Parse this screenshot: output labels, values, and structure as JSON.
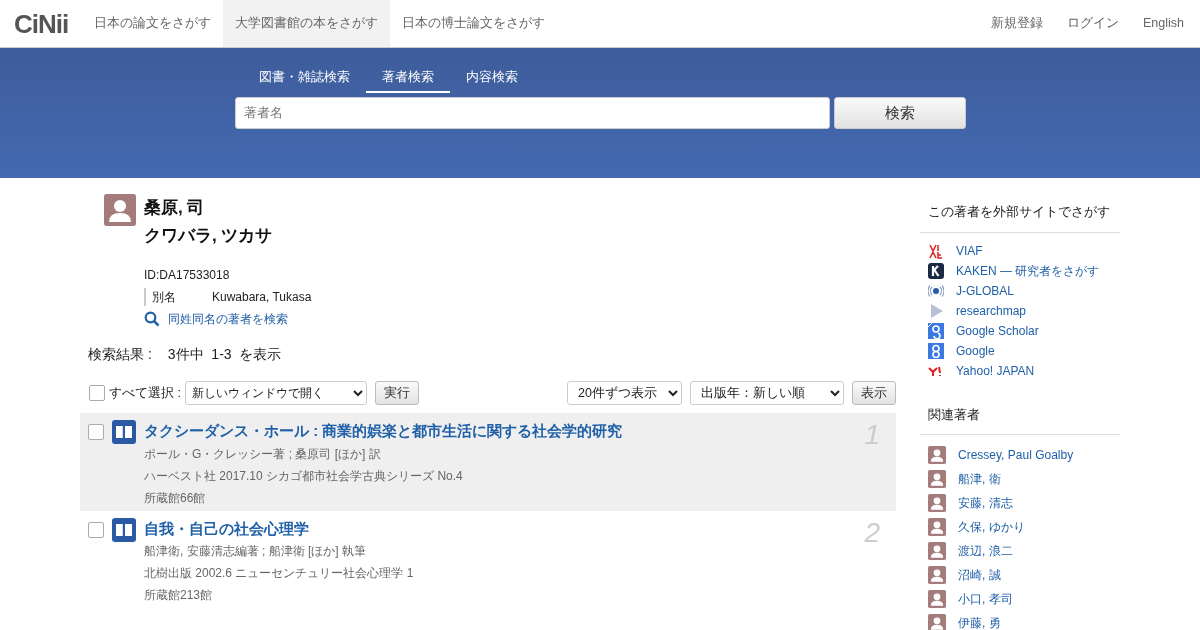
{
  "header": {
    "logo": "CiNii",
    "nav": [
      {
        "label": "日本の論文をさがす",
        "selected": false
      },
      {
        "label": "大学図書館の本をさがす",
        "selected": true
      },
      {
        "label": "日本の博士論文をさがす",
        "selected": false
      }
    ],
    "right_links": [
      "新規登録",
      "ログイン",
      "English"
    ]
  },
  "search": {
    "tabs": [
      {
        "label": "図書・雑誌検索",
        "selected": false
      },
      {
        "label": "著者検索",
        "selected": true
      },
      {
        "label": "内容検索",
        "selected": false
      }
    ],
    "placeholder": "著者名",
    "button": "検索"
  },
  "author": {
    "name": "桑原, 司",
    "kana": "クワバラ, ツカサ",
    "id": "ID:DA17533018",
    "alias_label": "別名",
    "alias": "Kuwabara, Tukasa",
    "same_name_link": "同姓同名の著者を検索"
  },
  "results": {
    "summary_label": "検索結果 :",
    "summary": "3件中  1-3  を表示",
    "select_all": {
      "label": "すべて選択 :",
      "checked": false
    },
    "action_select": "新しいウィンドウで開く",
    "action_button": "実行",
    "per_page_select": "20件ずつ表示",
    "sort_select": "出版年：新しい順",
    "show_button": "表示",
    "rows": [
      {
        "number": "1",
        "title": "タクシーダンス・ホール : 商業的娯楽と都市生活に関する社会学的研究",
        "authors": "ポール・G・クレッシー著 ; 桑原司 [ほか] 訳",
        "publication": "ハーベスト社 2017.10 シカゴ都市社会学古典シリーズ No.4",
        "holdings": "所蔵館66館",
        "checked": false,
        "highlighted": true
      },
      {
        "number": "2",
        "title": "自我・自己の社会心理学",
        "authors": "船津衛, 安藤清志編著 ; 船津衛 [ほか] 執筆",
        "publication": "北樹出版 2002.6 ニューセンチュリー社会心理学 1",
        "holdings": "所蔵館213館",
        "checked": false,
        "highlighted": false
      }
    ]
  },
  "sidebar": {
    "external_title": "この著者を外部サイトでさがす",
    "external_sites": [
      {
        "label": "VIAF",
        "kind": "viaf"
      },
      {
        "label": "KAKEN — 研究者をさがす",
        "kind": "kaken"
      },
      {
        "label": "J-GLOBAL",
        "kind": "jglobal"
      },
      {
        "label": "researchmap",
        "kind": "researchmap"
      },
      {
        "label": "Google Scholar",
        "kind": "scholar"
      },
      {
        "label": "Google",
        "kind": "google"
      },
      {
        "label": "Yahoo! JAPAN",
        "kind": "yahoo"
      }
    ],
    "related_title": "関連著者",
    "related_authors": [
      "Cressey, Paul Goalby",
      "船津, 衛",
      "安藤, 清志",
      "久保, ゆかり",
      "渡辺, 浪二",
      "沼崎, 誠",
      "小口, 孝司",
      "伊藤, 勇"
    ]
  }
}
